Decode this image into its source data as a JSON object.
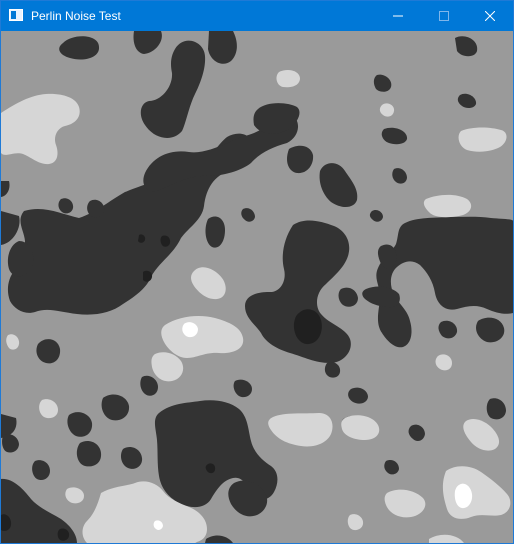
{
  "window": {
    "title": "Perlin Noise Test",
    "icon": "app-window-icon",
    "controls": {
      "minimize": "minimize-icon",
      "maximize": "maximize-icon",
      "close": "close-icon"
    }
  },
  "colors": {
    "titlebar": "#0078d7",
    "background_gray": "#9a9a9a",
    "dark_patch": "#333333",
    "darker_patch": "#202020",
    "light_patch": "#d6d6d6",
    "white_patch": "#ffffff"
  }
}
